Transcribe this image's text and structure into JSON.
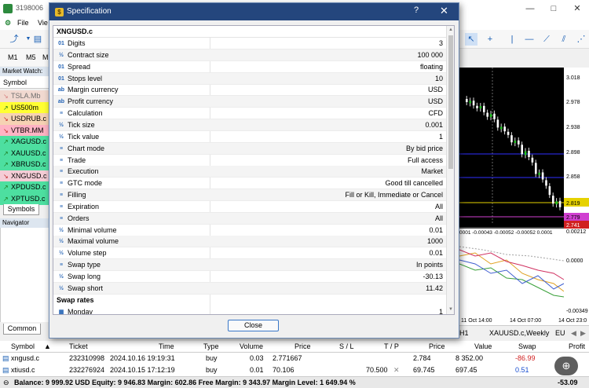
{
  "window": {
    "title": "3198006",
    "controls": [
      "—",
      "□",
      "✕"
    ]
  },
  "menu": {
    "items": [
      "File",
      "Vie"
    ]
  },
  "toolbar": {
    "icons": [
      "chart-icon",
      "dropdown-icon",
      "cursor-icon",
      "crosshair-icon",
      "vertical-line-icon",
      "horizontal-line-icon",
      "trendline-icon",
      "channel-icon",
      "fibonacci-icon"
    ]
  },
  "timeframes": [
    "M1",
    "M5",
    "M"
  ],
  "market_watch": {
    "title": "Market Watch:",
    "column": "Symbol",
    "symbols": [
      {
        "name": "TSLA.Mb",
        "dir": "down",
        "bg": "#f3c8b6"
      },
      {
        "name": "US500m",
        "dir": "up",
        "bg": "#ffff33"
      },
      {
        "name": "USDRUB.c",
        "dir": "down",
        "bg": "#f6d2b3"
      },
      {
        "name": "VTBR.MM",
        "dir": "down",
        "bg": "#ffb3c4"
      },
      {
        "name": "XAGUSD.c",
        "dir": "up",
        "bg": "#4ddfa0"
      },
      {
        "name": "XAUUSD.c",
        "dir": "up",
        "bg": "#4ddfa0"
      },
      {
        "name": "XBRUSD.c",
        "dir": "up",
        "bg": "#4ddfa0"
      },
      {
        "name": "XNGUSD.c",
        "dir": "down",
        "bg": "#f4cdd6"
      },
      {
        "name": "XPDUSD.c",
        "dir": "up",
        "bg": "#4ddfa0"
      },
      {
        "name": "XPTUSD.c",
        "dir": "up",
        "bg": "#4ddfa0"
      }
    ],
    "tab": "Symbols"
  },
  "navigator": {
    "title": "Navigator",
    "tab": "Common"
  },
  "dialog": {
    "title": "Specification",
    "help": "?",
    "close_x": "✕",
    "symbol": "XNGUSD.c",
    "rows": [
      {
        "icon": "01",
        "name": "Digits",
        "value": "3"
      },
      {
        "icon": "½",
        "name": "Contract size",
        "value": "100 000"
      },
      {
        "icon": "01",
        "name": "Spread",
        "value": "floating"
      },
      {
        "icon": "01",
        "name": "Stops level",
        "value": "10"
      },
      {
        "icon": "ab",
        "name": "Margin currency",
        "value": "USD"
      },
      {
        "icon": "ab",
        "name": "Profit currency",
        "value": "USD"
      },
      {
        "icon": "≡",
        "name": "Calculation",
        "value": "CFD"
      },
      {
        "icon": "½",
        "name": "Tick size",
        "value": "0.001"
      },
      {
        "icon": "½",
        "name": "Tick value",
        "value": "1"
      },
      {
        "icon": "≡",
        "name": "Chart mode",
        "value": "By bid price"
      },
      {
        "icon": "≡",
        "name": "Trade",
        "value": "Full access"
      },
      {
        "icon": "≡",
        "name": "Execution",
        "value": "Market"
      },
      {
        "icon": "≡",
        "name": "GTC mode",
        "value": "Good till cancelled"
      },
      {
        "icon": "≡",
        "name": "Filling",
        "value": "Fill or Kill, Immediate or Cancel"
      },
      {
        "icon": "≡",
        "name": "Expiration",
        "value": "All"
      },
      {
        "icon": "≡",
        "name": "Orders",
        "value": "All"
      },
      {
        "icon": "½",
        "name": "Minimal volume",
        "value": "0.01"
      },
      {
        "icon": "½",
        "name": "Maximal volume",
        "value": "1000"
      },
      {
        "icon": "½",
        "name": "Volume step",
        "value": "0.01"
      },
      {
        "icon": "≡",
        "name": "Swap type",
        "value": "In points"
      },
      {
        "icon": "½",
        "name": "Swap long",
        "value": "-30.13"
      },
      {
        "icon": "½",
        "name": "Swap short",
        "value": "11.42"
      }
    ],
    "section": "Swap rates",
    "swap_rows": [
      {
        "icon": "▦",
        "name": "Monday",
        "value": "1"
      }
    ],
    "close_button": "Close"
  },
  "chart": {
    "price_labels": [
      "3.018",
      "2.978",
      "2.938",
      "2.898",
      "2.858",
      "2.819",
      "2.779",
      "2.741"
    ],
    "indicator_labels": [
      "0001 -0.00043 -0.00052 -0.00052 0.0001",
      "0.00212",
      "0.0000",
      "-0.00349"
    ],
    "time_labels": [
      "11 Oct 14:00",
      "14 Oct 07:00",
      "14 Oct 23:0"
    ],
    "tabs": [
      "H1",
      "XAUUSD.c,Weekly",
      "EU"
    ]
  },
  "trades": {
    "columns": [
      "Symbol",
      "Ticket",
      "Time",
      "Type",
      "Volume",
      "Price",
      "S / L",
      "T / P",
      "Price",
      "Value",
      "Swap",
      "Profit"
    ],
    "rows": [
      {
        "symbol": "xngusd.c",
        "ticket": "232310998",
        "time": "2024.10.16 19:19:31",
        "type": "buy",
        "volume": "0.03",
        "price": "2.771667",
        "sl": "",
        "tp": "",
        "cur_price": "2.784",
        "value": "8 352.00",
        "swap": "-86.99",
        "profit": ""
      },
      {
        "symbol": "xtiusd.c",
        "ticket": "232276924",
        "time": "2024.10.15 17:12:19",
        "type": "buy",
        "volume": "0.01",
        "price": "70.106",
        "sl": "",
        "tp": "70.500",
        "cur_price": "69.745",
        "value": "697.45",
        "swap": "0.51",
        "profit": ""
      }
    ],
    "balance_line": "Balance: 9 999.92 USD  Equity: 9 946.83  Margin: 602.86  Free Margin: 9 343.97  Margin Level: 1 649.94 %",
    "total_profit": "-53.09"
  }
}
